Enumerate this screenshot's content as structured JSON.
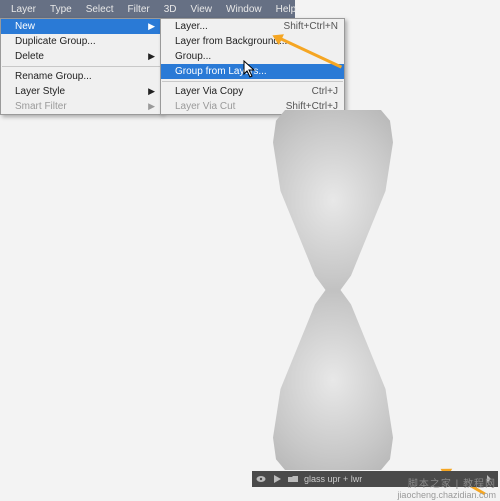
{
  "menubar": {
    "items": [
      "Layer",
      "Type",
      "Select",
      "Filter",
      "3D",
      "View",
      "Window",
      "Help"
    ]
  },
  "layer_menu": {
    "new": "New",
    "duplicate_group": "Duplicate Group...",
    "delete": "Delete",
    "rename_group": "Rename Group...",
    "layer_style": "Layer Style",
    "smart_filter": "Smart Filter"
  },
  "new_menu": {
    "layer": {
      "label": "Layer...",
      "shortcut": "Shift+Ctrl+N"
    },
    "layer_from_bg": "Layer from Background...",
    "group": "Group...",
    "group_from_layers": "Group from Layers...",
    "layer_via_copy": {
      "label": "Layer Via Copy",
      "shortcut": "Ctrl+J"
    },
    "layer_via_cut": {
      "label": "Layer Via Cut",
      "shortcut": "Shift+Ctrl+J"
    }
  },
  "statusbar": {
    "path": "glass upr + lwr"
  },
  "watermark": {
    "line1": "脚本之家 | 教程网",
    "line2": "jiaocheng.chazidian.com"
  }
}
